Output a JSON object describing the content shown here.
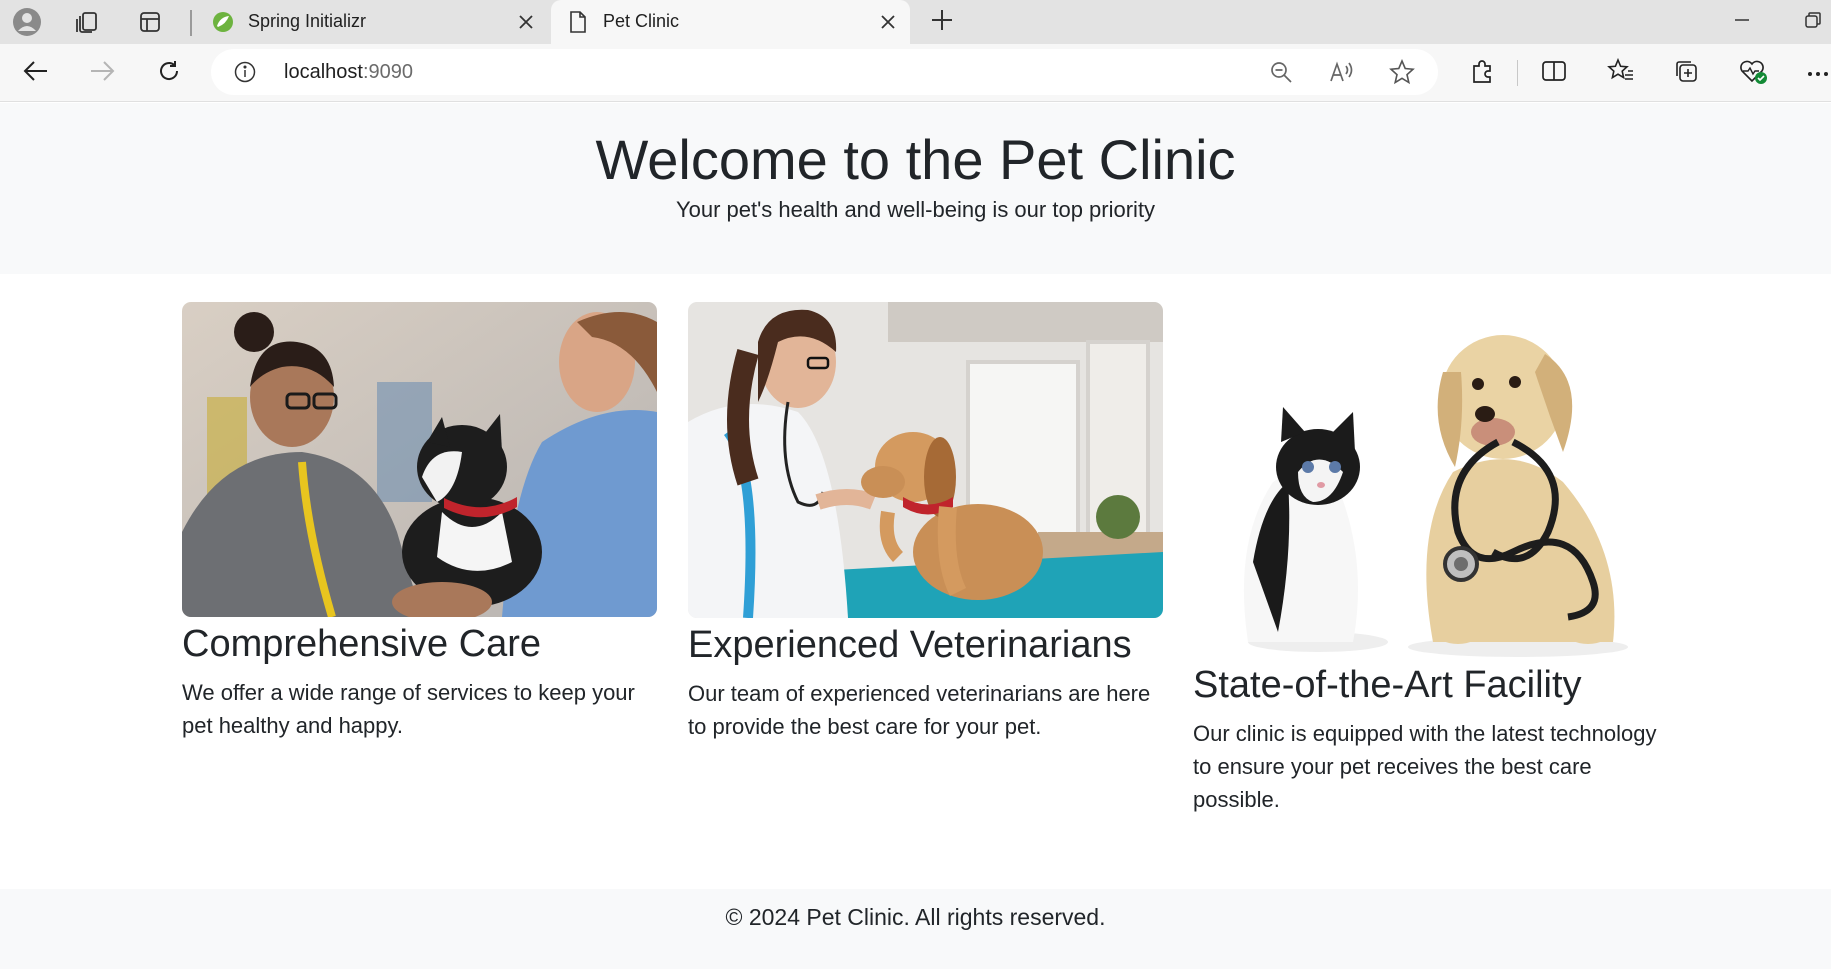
{
  "browser": {
    "tabs": [
      {
        "title": "Spring Initializr",
        "active": false
      },
      {
        "title": "Pet Clinic",
        "active": true
      }
    ],
    "address": {
      "host": "localhost",
      "port": ":9090"
    },
    "icons": [
      "profile-icon",
      "workspaces-icon",
      "tab-actions-icon",
      "spring-logo-icon",
      "page-icon",
      "close-icon",
      "plus-icon",
      "minimize-icon",
      "restore-icon",
      "back-arrow-icon",
      "forward-arrow-icon",
      "refresh-icon",
      "info-icon",
      "zoom-out-icon",
      "read-aloud-icon",
      "star-icon",
      "extensions-icon",
      "split-screen-icon",
      "favorites-icon",
      "collections-icon",
      "browser-essentials-icon",
      "more-icon"
    ]
  },
  "hero": {
    "title": "Welcome to the Pet Clinic",
    "subtitle": "Your pet's health and well-being is our top priority"
  },
  "cards": [
    {
      "title": "Comprehensive Care",
      "text": "We offer a wide range of services to keep your pet healthy and happy."
    },
    {
      "title": "Experienced Veterinarians",
      "text": "Our team of experienced veterinarians are here to provide the best care for your pet."
    },
    {
      "title": "State-of-the-Art Facility",
      "text": "Our clinic is equipped with the latest technology to ensure your pet receives the best care possible."
    }
  ],
  "footer": {
    "text": "© 2024 Pet Clinic. All rights reserved."
  },
  "colors": {
    "hero_bg": "#f8f9fa",
    "text": "#212529",
    "chrome_bg": "#e3e3e3",
    "toolbar_bg": "#f7f7f7"
  }
}
